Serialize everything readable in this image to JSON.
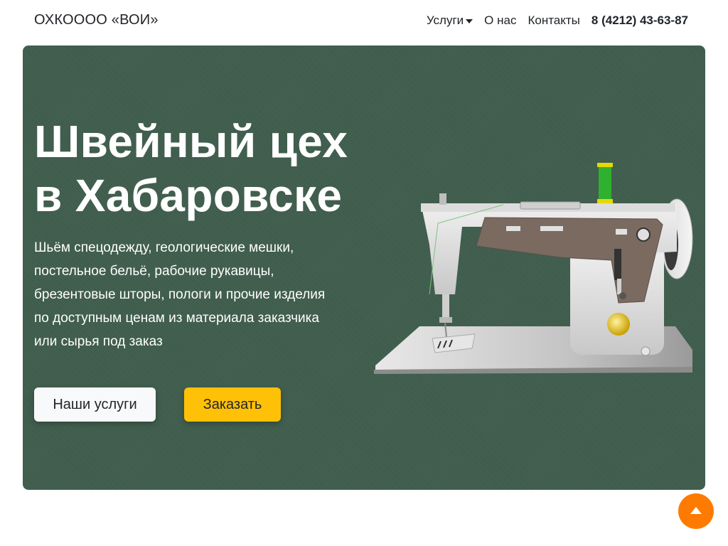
{
  "navbar": {
    "brand": "ОХКОООО «ВОИ»",
    "links": [
      {
        "label": "Услуги"
      },
      {
        "label": "О нас"
      },
      {
        "label": "Контакты"
      }
    ],
    "phone": "8 (4212) 43-63-87"
  },
  "hero": {
    "title_lines": [
      "Швейный цех",
      "в Хабаровске"
    ],
    "text_lines": [
      "Шьём спецодежду, геологические мешки,",
      "постельное бельё, рабочие рукавицы,",
      "брезентовые шторы, пологи и прочие изделия",
      "по доступным ценам из материала заказчика",
      "или сырья под заказ"
    ],
    "buttons": {
      "services": "Наши услуги",
      "order": "Заказать"
    }
  },
  "icons": {
    "sewing_machine": "sewing-machine-illustration",
    "scroll_top": "arrow-up-icon"
  },
  "colors": {
    "hero_bg": "#3f5d4d",
    "order_button": "#ffc107",
    "scroll_top": "#ff7a00"
  }
}
